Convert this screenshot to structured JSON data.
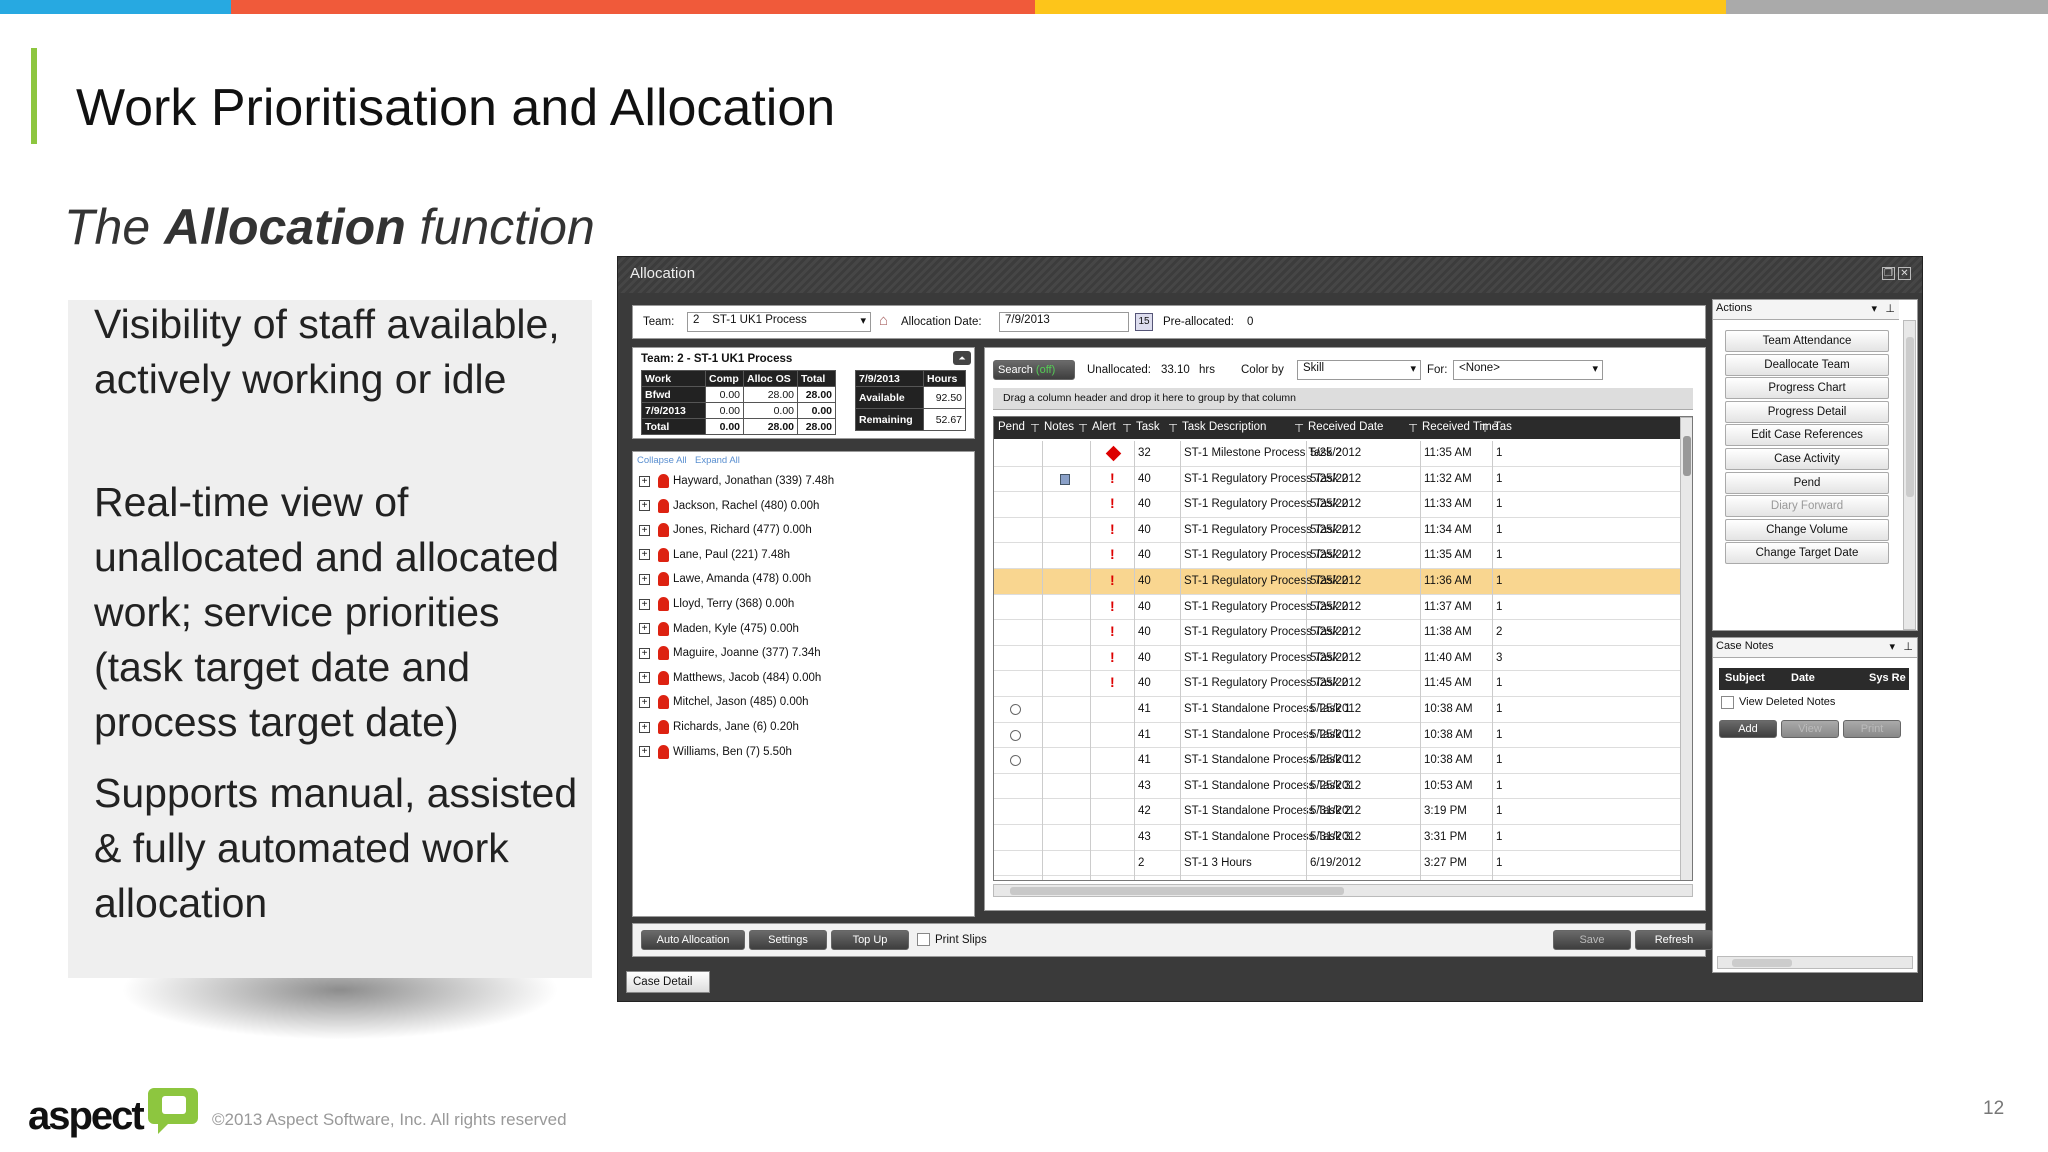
{
  "colors": {
    "bar1": "#27a9e1",
    "bar2": "#f05a3a",
    "bar3": "#fdc51a",
    "bar4": "#aaaaaa",
    "accent": "#8dc63f",
    "logo_green": "#8dc63f"
  },
  "slide": {
    "title": "Work Prioritisation and Allocation",
    "subtitle_pre": "The ",
    "subtitle_bold": "Allocation",
    "subtitle_post": " function",
    "bullets": [
      "Visibility of staff available, actively working or idle",
      "Real-time view of unallocated and allocated work; service priorities (task target date and process target date)",
      "Supports manual, assisted & fully automated work allocation"
    ],
    "logo_text": "aspect",
    "copyright": "©2013 Aspect Software, Inc. All rights reserved",
    "page_number": "12"
  },
  "app": {
    "window_title": "Allocation",
    "team_label": "Team:",
    "team_id": "2",
    "team_name": "ST-1 UK1 Process",
    "allocation_date_label": "Allocation Date:",
    "allocation_date": "7/9/2013",
    "calendar_day": "15",
    "preallocated_label": "Pre-allocated:",
    "preallocated_value": "0",
    "team_header": "Team: 2 - ST-1 UK1 Process",
    "summary": {
      "headers": [
        "Work",
        "Comp",
        "Alloc OS",
        "Total"
      ],
      "rows": [
        [
          "Bfwd",
          "0.00",
          "28.00",
          "28.00"
        ],
        [
          "7/9/2013",
          "0.00",
          "0.00",
          "0.00"
        ],
        [
          "Total",
          "0.00",
          "28.00",
          "28.00"
        ]
      ],
      "date_header": "7/9/2013",
      "hours_header": "Hours",
      "available_label": "Available",
      "available_value": "92.50",
      "remaining_label": "Remaining",
      "remaining_value": "52.67"
    },
    "collapse_all": "Collapse All",
    "expand_all": "Expand All",
    "staff": [
      "Hayward, Jonathan (339) 7.48h",
      "Jackson, Rachel (480) 0.00h",
      "Jones, Richard (477) 0.00h",
      "Lane, Paul (221) 7.48h",
      "Lawe, Amanda (478) 0.00h",
      "Lloyd, Terry (368) 0.00h",
      "Maden, Kyle (475) 0.00h",
      "Maguire, Joanne (377) 7.34h",
      "Matthews, Jacob (484) 0.00h",
      "Mitchel, Jason (485) 0.00h",
      "Richards, Jane (6) 0.20h",
      "Williams, Ben (7) 5.50h"
    ],
    "search_label": "Search",
    "search_state": "(off)",
    "unallocated_label": "Unallocated:",
    "unallocated_value": "33.10",
    "unallocated_unit": "hrs",
    "color_by_label": "Color by",
    "color_by_value": "Skill",
    "for_label": "For:",
    "for_value": "<None>",
    "group_hint": "Drag a column header and drop it here to group by that column",
    "columns": [
      "Pend",
      "Notes",
      "Alert",
      "Task",
      "Task Description",
      "Received Date",
      "Received Time",
      "Tas"
    ],
    "tasks": [
      {
        "pend": "",
        "notes": "",
        "alert": "diamond",
        "task": "32",
        "desc": "ST-1 Milestone Process Task 2",
        "date": "5/25/2012",
        "time": "11:35 AM",
        "tas": "1"
      },
      {
        "pend": "",
        "notes": "note",
        "alert": "exclaim",
        "task": "40",
        "desc": "ST-1 Regulatory Process Task 2",
        "date": "5/25/2012",
        "time": "11:32 AM",
        "tas": "1"
      },
      {
        "pend": "",
        "notes": "",
        "alert": "exclaim",
        "task": "40",
        "desc": "ST-1 Regulatory Process Task 2",
        "date": "5/25/2012",
        "time": "11:33 AM",
        "tas": "1"
      },
      {
        "pend": "",
        "notes": "",
        "alert": "exclaim",
        "task": "40",
        "desc": "ST-1 Regulatory Process Task 2",
        "date": "5/25/2012",
        "time": "11:34 AM",
        "tas": "1"
      },
      {
        "pend": "",
        "notes": "",
        "alert": "exclaim",
        "task": "40",
        "desc": "ST-1 Regulatory Process Task 2",
        "date": "5/25/2012",
        "time": "11:35 AM",
        "tas": "1"
      },
      {
        "pend": "",
        "notes": "",
        "alert": "exclaim",
        "task": "40",
        "desc": "ST-1 Regulatory Process Task 2",
        "date": "5/25/2012",
        "time": "11:36 AM",
        "tas": "1",
        "selected": true
      },
      {
        "pend": "",
        "notes": "",
        "alert": "exclaim",
        "task": "40",
        "desc": "ST-1 Regulatory Process Task 2",
        "date": "5/25/2012",
        "time": "11:37 AM",
        "tas": "1"
      },
      {
        "pend": "",
        "notes": "",
        "alert": "exclaim",
        "task": "40",
        "desc": "ST-1 Regulatory Process Task 2",
        "date": "5/25/2012",
        "time": "11:38 AM",
        "tas": "2"
      },
      {
        "pend": "",
        "notes": "",
        "alert": "exclaim",
        "task": "40",
        "desc": "ST-1 Regulatory Process Task 2",
        "date": "5/25/2012",
        "time": "11:40 AM",
        "tas": "3"
      },
      {
        "pend": "",
        "notes": "",
        "alert": "exclaim",
        "task": "40",
        "desc": "ST-1 Regulatory Process Task 2",
        "date": "5/25/2012",
        "time": "11:45 AM",
        "tas": "1"
      },
      {
        "pend": "clock",
        "notes": "",
        "alert": "",
        "task": "41",
        "desc": "ST-1 Standalone Process Task 1",
        "date": "5/25/2012",
        "time": "10:38 AM",
        "tas": "1"
      },
      {
        "pend": "clock",
        "notes": "",
        "alert": "",
        "task": "41",
        "desc": "ST-1 Standalone Process Task 1",
        "date": "5/25/2012",
        "time": "10:38 AM",
        "tas": "1"
      },
      {
        "pend": "clock",
        "notes": "",
        "alert": "",
        "task": "41",
        "desc": "ST-1 Standalone Process Task 1",
        "date": "5/25/2012",
        "time": "10:38 AM",
        "tas": "1"
      },
      {
        "pend": "",
        "notes": "",
        "alert": "",
        "task": "43",
        "desc": "ST-1 Standalone Process Task 3",
        "date": "5/25/2012",
        "time": "10:53 AM",
        "tas": "1"
      },
      {
        "pend": "",
        "notes": "",
        "alert": "",
        "task": "42",
        "desc": "ST-1 Standalone Process Task 2",
        "date": "5/31/2012",
        "time": "3:19 PM",
        "tas": "1"
      },
      {
        "pend": "",
        "notes": "",
        "alert": "",
        "task": "43",
        "desc": "ST-1 Standalone Process Task 3",
        "date": "5/31/2012",
        "time": "3:31 PM",
        "tas": "1"
      },
      {
        "pend": "",
        "notes": "",
        "alert": "",
        "task": "2",
        "desc": "ST-1 3 Hours",
        "date": "6/19/2012",
        "time": "3:27 PM",
        "tas": "1"
      }
    ],
    "bottom_buttons": {
      "auto": "Auto Allocation",
      "settings": "Settings",
      "topup": "Top Up",
      "print_slips": "Print Slips",
      "save": "Save",
      "refresh": "Refresh"
    },
    "case_detail_tab": "Case Detail",
    "actions_title": "Actions",
    "actions": [
      {
        "label": "Team Attendance",
        "enabled": true
      },
      {
        "label": "Deallocate Team",
        "enabled": true
      },
      {
        "label": "Progress Chart",
        "enabled": true
      },
      {
        "label": "Progress Detail",
        "enabled": true
      },
      {
        "label": "Edit Case References",
        "enabled": true
      },
      {
        "label": "Case Activity",
        "enabled": true
      },
      {
        "label": "Pend",
        "enabled": true
      },
      {
        "label": "Diary Forward",
        "enabled": false
      },
      {
        "label": "Change Volume",
        "enabled": true
      },
      {
        "label": "Change Target Date",
        "enabled": true
      }
    ],
    "case_notes_title": "Case Notes",
    "case_notes_columns": [
      "Subject",
      "Date",
      "Sys Re"
    ],
    "view_deleted_notes": "View Deleted Notes",
    "notes_buttons": {
      "add": "Add",
      "view": "View",
      "print": "Print"
    }
  }
}
